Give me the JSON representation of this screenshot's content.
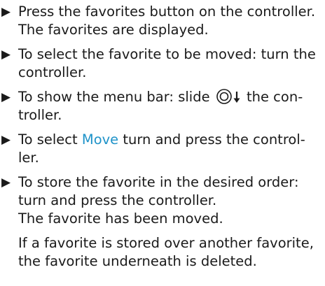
{
  "steps": [
    {
      "bullet": "▶",
      "text_line1": "Press the favorites button on the controller.",
      "result": "The favorites are displayed."
    },
    {
      "bullet": "▶",
      "text_line1": "To select the favorite to be moved: turn the",
      "text_line2": "controller."
    },
    {
      "bullet": "▶",
      "text_before_icon": "To show the menu bar: slide ",
      "icon": "controller-slide-down-icon",
      "text_after_icon": " the con-",
      "text_line2": "troller."
    },
    {
      "bullet": "▶",
      "text_before_highlight": "To select ",
      "highlight": "Move",
      "text_after_highlight": " turn and press the control-",
      "text_line2": "ler."
    },
    {
      "bullet": "▶",
      "text_line1": "To store the favorite in the desired order:",
      "text_line2": "turn and press the controller.",
      "result": "The favorite has been moved.",
      "note_line1": "If a favorite is stored over another favorite,",
      "note_line2": "the favorite underneath is deleted."
    }
  ],
  "colors": {
    "highlight": "#1f93c9",
    "text": "#1a1a1a"
  }
}
